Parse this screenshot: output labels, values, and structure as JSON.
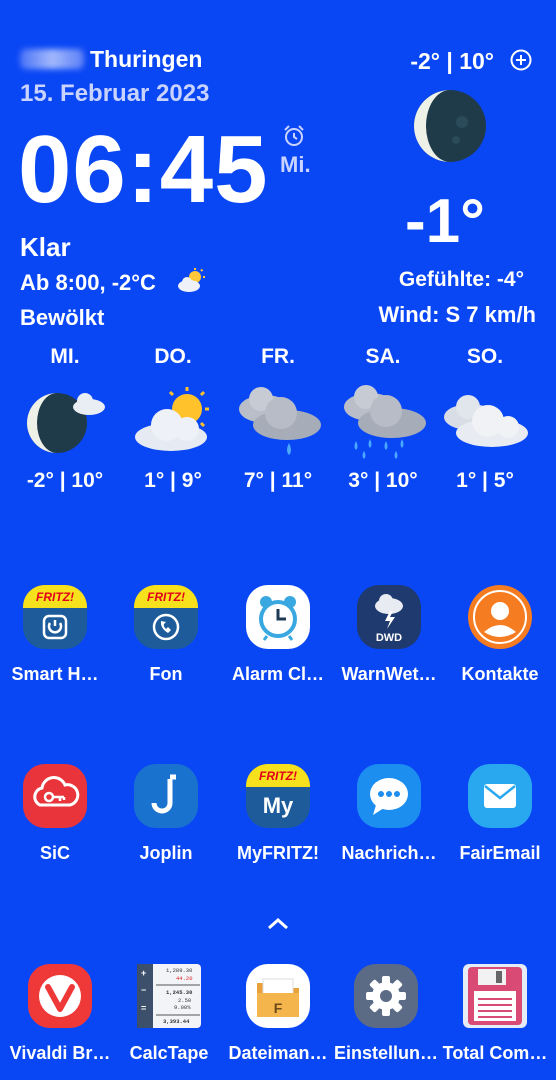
{
  "header": {
    "location": "Thuringen",
    "date": "15. Februar 2023",
    "time": "06:45",
    "weekday": "Mi.",
    "condition": "Klar",
    "later_line": "Ab 8:00, -2°C",
    "later_condition": "Bewölkt",
    "range": "-2° | 10°",
    "temperature": "-1°",
    "feels_like": "Gefühlte: -4°",
    "wind": "Wind: S 7 km/h"
  },
  "forecast": [
    {
      "day": "MI.",
      "temps": "-2° | 10°",
      "icon": "moon-cloud-icon"
    },
    {
      "day": "DO.",
      "temps": "1° | 9°",
      "icon": "sun-cloud-icon"
    },
    {
      "day": "FR.",
      "temps": "7° | 11°",
      "icon": "rain-cloud-icon"
    },
    {
      "day": "SA.",
      "temps": "3° | 10°",
      "icon": "heavy-rain-cloud-icon"
    },
    {
      "day": "SO.",
      "temps": "1° | 5°",
      "icon": "cloud-icon"
    }
  ],
  "apps_row1": [
    {
      "label": "Smart H…",
      "icon": "fritz-smart-home-icon"
    },
    {
      "label": "Fon",
      "icon": "fritz-fon-icon"
    },
    {
      "label": "Alarm Cl…",
      "icon": "alarm-clock-icon"
    },
    {
      "label": "WarnWet…",
      "icon": "dwd-warnwetter-icon"
    },
    {
      "label": "Kontakte",
      "icon": "contacts-icon"
    }
  ],
  "apps_row2": [
    {
      "label": "SiC",
      "icon": "sic-cloud-key-icon"
    },
    {
      "label": "Joplin",
      "icon": "joplin-icon"
    },
    {
      "label": "MyFRITZ!",
      "icon": "myfritz-icon"
    },
    {
      "label": "Nachrich…",
      "icon": "messages-icon"
    },
    {
      "label": "FairEmail",
      "icon": "email-icon"
    }
  ],
  "dock": [
    {
      "label": "Vivaldi Br…",
      "icon": "vivaldi-icon"
    },
    {
      "label": "CalcTape",
      "icon": "calctape-icon"
    },
    {
      "label": "Dateiman…",
      "icon": "file-manager-icon"
    },
    {
      "label": "Einstellun…",
      "icon": "settings-gear-icon"
    },
    {
      "label": "Total Com…",
      "icon": "total-commander-icon"
    }
  ],
  "fritz_badge": "FRITZ!",
  "myfritz_text": "My",
  "dwd_text": "DWD",
  "calctape_numbers": [
    "1,289.30",
    "44.20",
    "1,245.30",
    "2.50",
    "9.00%",
    "3,393.44"
  ],
  "colors": {
    "background": "#0a47f4",
    "subtext": "#c9d3ff"
  }
}
